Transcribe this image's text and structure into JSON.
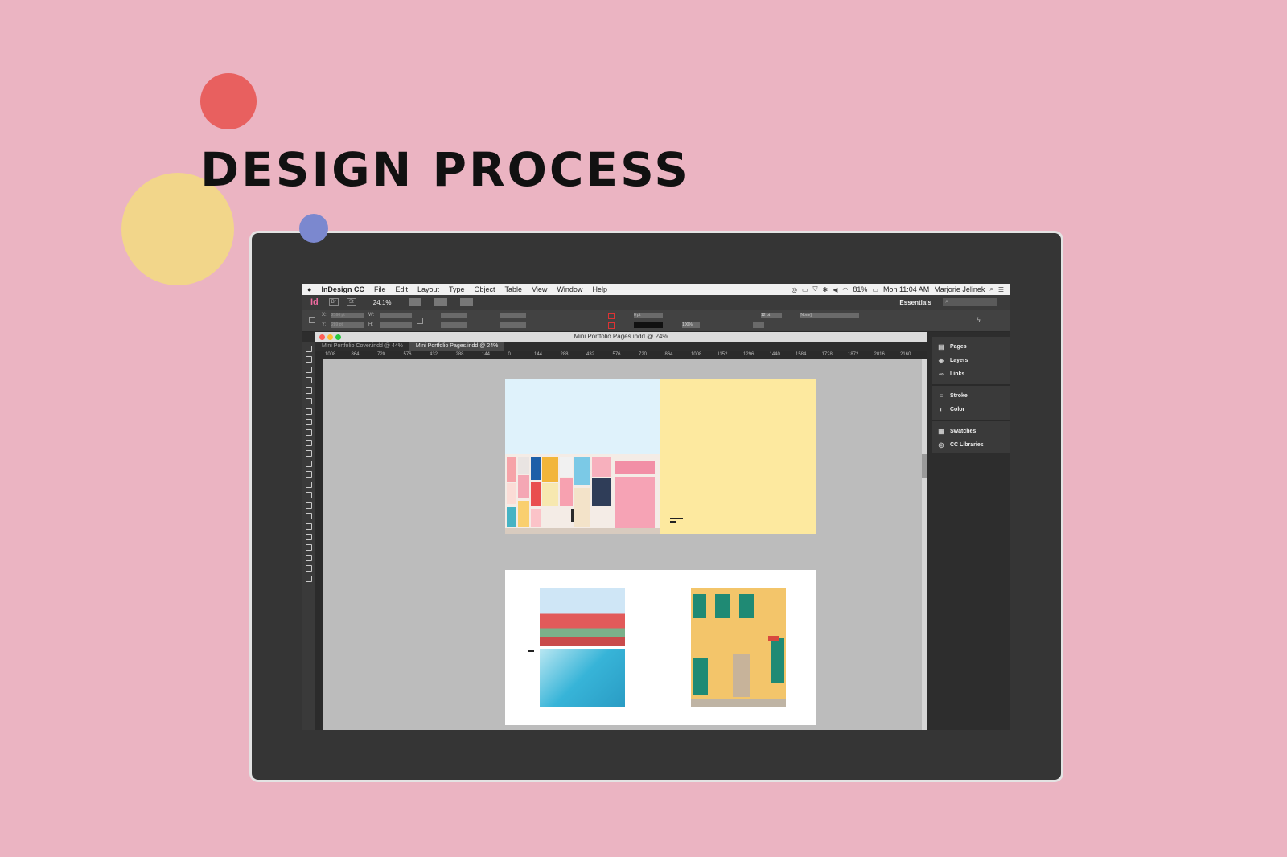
{
  "page": {
    "headline": "DESIGN PROCESS"
  },
  "menubar": {
    "apple": "",
    "app_name": "InDesign CC",
    "menus": [
      "File",
      "Edit",
      "Layout",
      "Type",
      "Object",
      "Table",
      "View",
      "Window",
      "Help"
    ],
    "battery": "81%",
    "clock": "Mon 11:04 AM",
    "user": "Marjorie Jelinek"
  },
  "appbar": {
    "logo": "Id",
    "btn_br": "Br",
    "btn_st": "St",
    "zoom": "24.1%",
    "workspace": "Essentials",
    "search_placeholder": "⌕"
  },
  "controlpanel": {
    "x_label": "X:",
    "y_label": "Y:",
    "w_label": "W:",
    "h_label": "H:",
    "x_value": "2160 pt",
    "y_value": "289 pt",
    "stroke_weight": "0 pt",
    "opacity": "100%",
    "font_size": "12 pt",
    "style": "[None]"
  },
  "document": {
    "title": "Mini Portfolio Pages.indd @ 24%",
    "tabs": [
      {
        "label": "Mini Portfolio Cover.indd @ 44%",
        "active": false
      },
      {
        "label": "Mini Portfolio Pages.indd @ 24%",
        "active": true
      }
    ],
    "ruler_ticks": [
      "1008",
      "864",
      "720",
      "576",
      "432",
      "288",
      "144",
      "0",
      "144",
      "288",
      "432",
      "576",
      "720",
      "864",
      "1008",
      "1152",
      "1296",
      "1440",
      "1584",
      "1728",
      "1872",
      "2016",
      "2160"
    ]
  },
  "panels": {
    "groups": [
      [
        "Pages",
        "Layers",
        "Links"
      ],
      [
        "Stroke",
        "Color"
      ],
      [
        "Swatches",
        "CC Libraries"
      ]
    ]
  },
  "colors": {
    "background": "#ebb4c2",
    "dot_red": "#e8605f",
    "dot_yellow": "#f2d68a",
    "dot_blue": "#7b88cf",
    "page_yellow": "#fde99f",
    "sky": "#dff2fb"
  }
}
